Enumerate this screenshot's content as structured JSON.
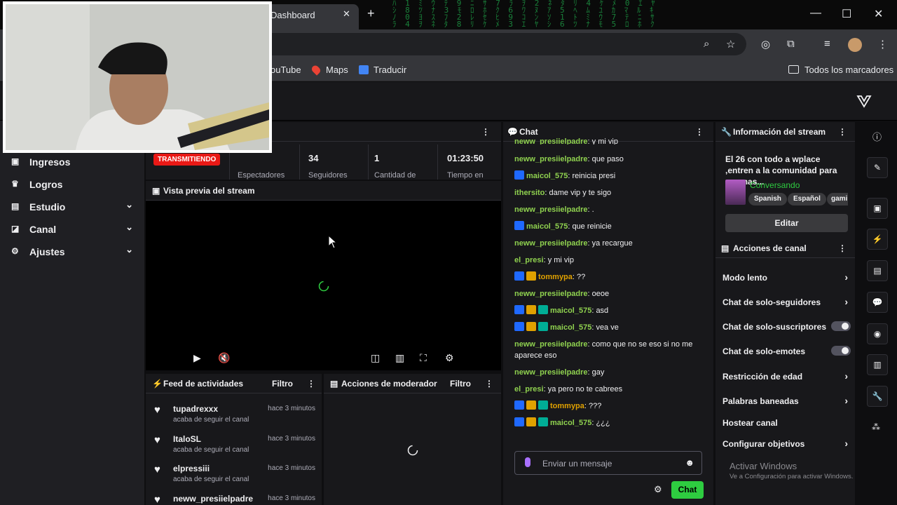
{
  "browser": {
    "tab_title": "Dashboard",
    "close_tab": "✕",
    "new_tab": "+",
    "bookmarks": [
      {
        "label": "ouTube"
      },
      {
        "label": "Maps"
      },
      {
        "label": "Traducir"
      }
    ],
    "all_bookmarks": "Todos los marcadores"
  },
  "sidebar": {
    "items": [
      {
        "label": "Ingresos",
        "icon": "money-icon",
        "expandable": false
      },
      {
        "label": "Logros",
        "icon": "trophy-icon",
        "expandable": false
      },
      {
        "label": "Estudio",
        "icon": "studio-icon",
        "expandable": true
      },
      {
        "label": "Canal",
        "icon": "channel-icon",
        "expandable": true
      },
      {
        "label": "Ajustes",
        "icon": "gear-icon",
        "expandable": true
      }
    ]
  },
  "stats": {
    "live_badge": "TRANSMITIENDO",
    "viewers_label": "Espectadores",
    "followers_value": "34",
    "followers_label": "Seguidores",
    "count_value": "1",
    "count_label": "Cantidad de",
    "time_value": "01:23:50",
    "time_label": "Tiempo en"
  },
  "preview": {
    "title": "Vista previa del stream"
  },
  "activity_feed": {
    "title": "Feed de actividades",
    "filter": "Filtro",
    "items": [
      {
        "name": "tupadrexxx",
        "time": "hace 3 minutos",
        "desc": "acaba de seguir el canal"
      },
      {
        "name": "ItaloSL",
        "time": "hace 3 minutos",
        "desc": "acaba de seguir el canal"
      },
      {
        "name": "elpressiii",
        "time": "hace 3 minutos",
        "desc": "acaba de seguir el canal"
      },
      {
        "name": "neww_presiielpadre",
        "time": "hace 3 minutos",
        "desc": ""
      }
    ]
  },
  "mod_actions": {
    "title": "Acciones de moderador",
    "filter": "Filtro"
  },
  "chat": {
    "title": "Chat",
    "messages": [
      {
        "user": "neww_presiielpadre",
        "color": "#8fd14f",
        "badges": [],
        "text": "y mi vip"
      },
      {
        "user": "neww_presiielpadre",
        "color": "#8fd14f",
        "badges": [],
        "text": "que paso"
      },
      {
        "user": "maicol_575",
        "color": "#8fd14f",
        "badges": [
          "mod"
        ],
        "text": "reinicia presi"
      },
      {
        "user": "ithersito",
        "color": "#8fd14f",
        "badges": [],
        "text": "dame vip y te sigo"
      },
      {
        "user": "neww_presiielpadre",
        "color": "#8fd14f",
        "badges": [],
        "text": "."
      },
      {
        "user": "maicol_575",
        "color": "#8fd14f",
        "badges": [
          "mod"
        ],
        "text": "que reinicie"
      },
      {
        "user": "neww_presiielpadre",
        "color": "#8fd14f",
        "badges": [],
        "text": "ya recargue"
      },
      {
        "user": "el_presi",
        "color": "#8fd14f",
        "badges": [],
        "text": "y mi vip"
      },
      {
        "user": "tommypa",
        "color": "#e0a100",
        "badges": [
          "mod",
          "vip"
        ],
        "text": "??"
      },
      {
        "user": "neww_presiielpadre",
        "color": "#8fd14f",
        "badges": [],
        "text": "oeoe"
      },
      {
        "user": "maicol_575",
        "color": "#8fd14f",
        "badges": [
          "mod",
          "vip",
          "sub"
        ],
        "text": "asd"
      },
      {
        "user": "maicol_575",
        "color": "#8fd14f",
        "badges": [
          "mod",
          "vip",
          "sub"
        ],
        "text": "vea ve"
      },
      {
        "user": "neww_presiielpadre",
        "color": "#8fd14f",
        "badges": [],
        "text": "como que no se eso si no me aparece eso"
      },
      {
        "user": "neww_presiielpadre",
        "color": "#8fd14f",
        "badges": [],
        "text": "gay"
      },
      {
        "user": "el_presi",
        "color": "#8fd14f",
        "badges": [],
        "text": "ya pero no te cabrees"
      },
      {
        "user": "tommypa",
        "color": "#e0a100",
        "badges": [
          "mod",
          "vip",
          "sub"
        ],
        "text": "???"
      },
      {
        "user": "maicol_575",
        "color": "#8fd14f",
        "badges": [
          "mod",
          "vip",
          "sub"
        ],
        "text": "¿¿¿"
      }
    ],
    "input_placeholder": "Enviar un mensaje",
    "send_label": "Chat"
  },
  "stream_info": {
    "title": "Información del stream",
    "description": "El 26 con todo a wplace ,entren a la comunidad para ser mas...",
    "category": "Conversando",
    "tags": [
      "Spanish",
      "Español",
      "gami"
    ],
    "edit_label": "Editar"
  },
  "channel_actions": {
    "title": "Acciones de canal",
    "items": [
      {
        "label": "Modo lento",
        "type": "chevron"
      },
      {
        "label": "Chat de solo-seguidores",
        "type": "chevron"
      },
      {
        "label": "Chat de solo-suscriptores",
        "type": "toggle"
      },
      {
        "label": "Chat de solo-emotes",
        "type": "toggle"
      },
      {
        "label": "Restricción de edad",
        "type": "chevron"
      },
      {
        "label": "Palabras baneadas",
        "type": "chevron"
      },
      {
        "label": "Hostear canal",
        "type": "none"
      },
      {
        "label": "Configurar objetivos",
        "type": "chevron"
      }
    ]
  },
  "windows_watermark": {
    "line1": "Activar Windows",
    "line2": "Ve a Configuración para activar Windows."
  },
  "colors": {
    "accent_green": "#2ecc40",
    "live_red": "#e91916",
    "username_green": "#8fd14f"
  }
}
